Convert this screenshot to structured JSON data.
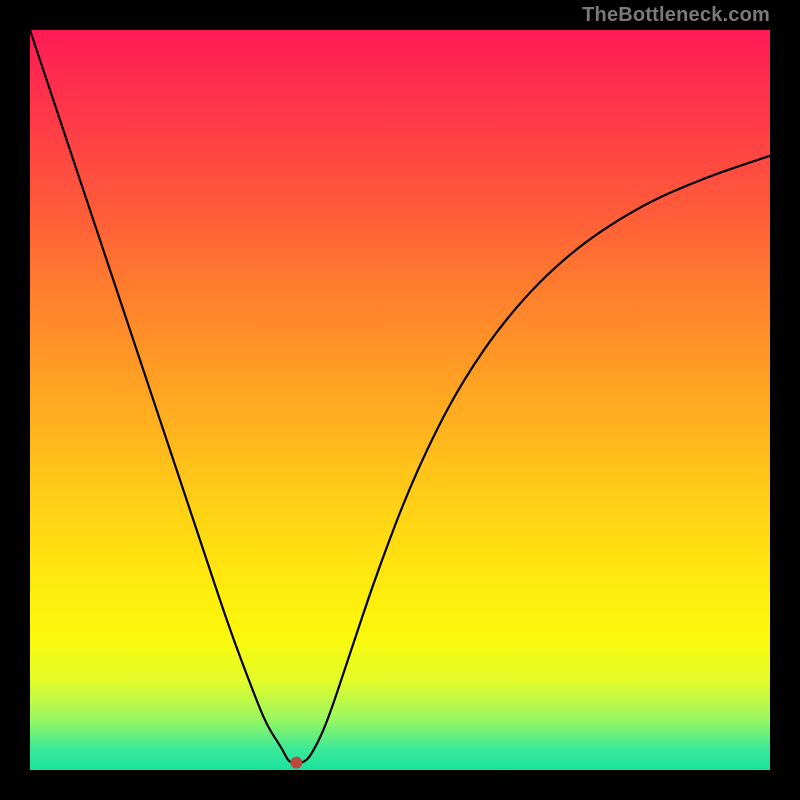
{
  "watermark": "TheBottleneck.com",
  "colors": {
    "frame": "#000000",
    "curve": "#000000",
    "dot": "#b74a3d",
    "gradient_stops": [
      "#ff1a55",
      "#ff2b4f",
      "#ff3f46",
      "#ff5a3a",
      "#ff7a2f",
      "#ff9726",
      "#ffb31e",
      "#ffd016",
      "#ffe80e",
      "#fbf90a",
      "#e2fb2a",
      "#9cf760",
      "#3fe996",
      "#18e3a2"
    ]
  },
  "chart_data": {
    "type": "line",
    "title": "",
    "xlabel": "",
    "ylabel": "",
    "xlim": [
      0,
      100
    ],
    "ylim": [
      0,
      100
    ],
    "annotations": [
      {
        "kind": "marker",
        "x": 36,
        "y": 1,
        "color": "#b74a3d"
      }
    ],
    "series": [
      {
        "name": "curve",
        "x": [
          0,
          3,
          6,
          9,
          12,
          15,
          18,
          21,
          24,
          27,
          30,
          32,
          34,
          35,
          36,
          37,
          38,
          40,
          43,
          47,
          52,
          58,
          65,
          73,
          82,
          91,
          100
        ],
        "y": [
          100,
          91,
          82,
          73,
          64,
          55,
          46,
          37,
          28,
          19,
          11,
          6,
          3,
          1,
          1,
          1,
          2,
          6,
          15,
          27,
          40,
          52,
          62,
          70,
          76,
          80,
          83
        ]
      }
    ]
  }
}
